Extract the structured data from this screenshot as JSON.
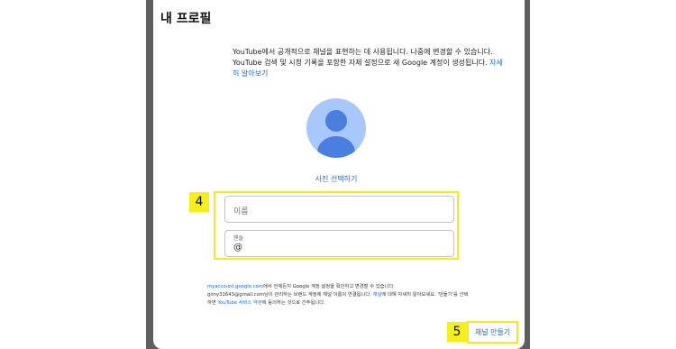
{
  "dialog": {
    "title": "내 프로필",
    "intro_text": "YouTube에서 공개적으로 채널을 표현하는 데 사용됩니다. 나중에 변경할 수 있습니다. YouTube 검색 및 시청 기록을 포함한 자체 설정으로 새 Google 계정이 생성됩니다.",
    "learn_more_link": "자세히 알아보기",
    "select_photo_link": "사진 선택하기",
    "name_field": {
      "placeholder": "이름",
      "value": ""
    },
    "handle_field": {
      "label": "핸들",
      "value": "@"
    },
    "footer": {
      "link1": "myaccount.google.com",
      "text1": "에서 언제든지 Google 계정 설정을 확인하고 변경할 수 있습니다.",
      "text2": "gimy31643@gmail.com님이 관리하는 브랜드 계정에 채널 이름이 연결됩니다.",
      "link2": "채널",
      "text3": "에 대해 자세히 알아보세요. '만들기'를 선택하면",
      "link3": "YouTube 서비스 약관",
      "text4": "에 동의하는 것으로 간주됩니다."
    },
    "create_button_label": "채널 만들기"
  },
  "annotations": {
    "marker_fields": "4",
    "marker_create": "5",
    "highlight_color": "#f4ec1a"
  }
}
